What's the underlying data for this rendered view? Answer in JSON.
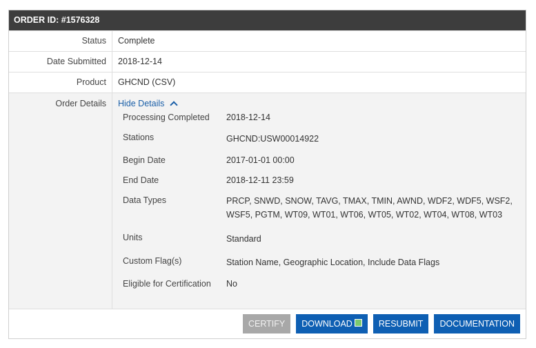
{
  "header": {
    "title": "ORDER ID: #1576328"
  },
  "rows": {
    "status": {
      "label": "Status",
      "value": "Complete"
    },
    "date_submitted": {
      "label": "Date Submitted",
      "value": "2018-12-14"
    },
    "product": {
      "label": "Product",
      "value": "GHCND (CSV)"
    },
    "order_details": {
      "label": "Order Details",
      "toggle_label": "Hide Details"
    }
  },
  "details": [
    {
      "key": "Processing Completed",
      "value": "2018-12-14"
    },
    {
      "key": "Stations",
      "value": "GHCND:USW00014922"
    },
    {
      "key": "Begin Date",
      "value": "2017-01-01 00:00"
    },
    {
      "key": "End Date",
      "value": "2018-12-11 23:59"
    },
    {
      "key": "Data Types",
      "value": "PRCP, SNWD, SNOW, TAVG, TMAX, TMIN, AWND, WDF2, WDF5, WSF2, WSF5, PGTM, WT09, WT01, WT06, WT05, WT02, WT04, WT08, WT03"
    },
    {
      "key": "Units",
      "value": "Standard"
    },
    {
      "key": "Custom Flag(s)",
      "value": "Station Name, Geographic Location, Include Data Flags"
    },
    {
      "key": "Eligible for Certification",
      "value": "No"
    }
  ],
  "buttons": {
    "certify": "CERTIFY",
    "download": "DOWNLOAD",
    "resubmit": "RESUBMIT",
    "documentation": "DOCUMENTATION"
  },
  "colors": {
    "header_bg": "#3d3d3d",
    "status_complete": "#2e9a2e",
    "link": "#1a5fa8",
    "button_primary": "#0e5fb3",
    "button_disabled": "#a8a8a8"
  },
  "icons": {
    "toggle": "chevron-up-icon",
    "download": "download-icon"
  }
}
